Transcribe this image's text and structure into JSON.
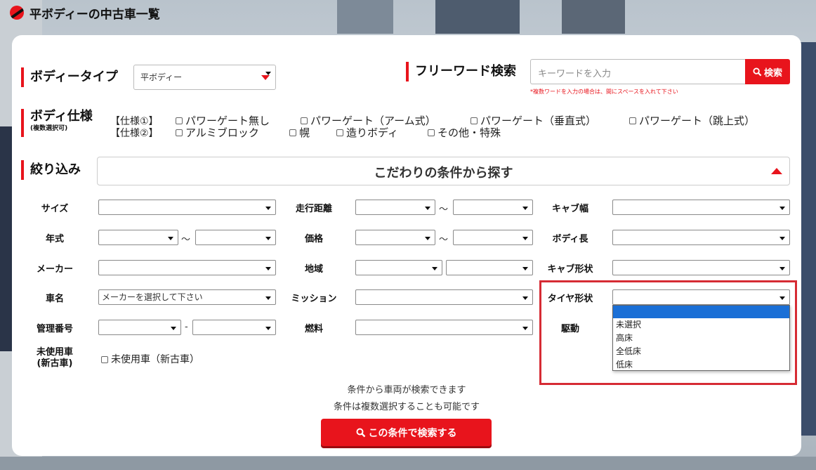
{
  "page": {
    "title": "平ボディーの中古車一覧"
  },
  "body_type": {
    "label": "ボディータイプ",
    "selected": "平ボディー"
  },
  "freeword": {
    "label": "フリーワード検索",
    "placeholder": "キーワードを入力",
    "button": "検索",
    "note": "*複数ワードを入力の場合は、間にスペースを入れて下さい"
  },
  "body_spec": {
    "label": "ボディ仕様",
    "sub": "(複数選択可)",
    "group1_label": "【仕様①】",
    "group1": [
      "パワーゲート無し",
      "パワーゲート（アーム式）",
      "パワーゲート（垂直式）",
      "パワーゲート（跳上式）"
    ],
    "group2_label": "【仕様②】",
    "group2": [
      "アルミブロック",
      "幌",
      "造りボディ",
      "その他・特殊"
    ]
  },
  "filter": {
    "label": "絞り込み",
    "bar_title": "こだわりの条件から探す"
  },
  "fields": {
    "size": "サイズ",
    "year": "年式",
    "maker": "メーカー",
    "car_name": "車名",
    "car_name_placeholder": "メーカーを選択して下さい",
    "mgmt_no": "管理番号",
    "unused": "未使用車\n(新古車)",
    "unused_checkbox": "未使用車（新古車）",
    "mileage": "走行距離",
    "price": "価格",
    "region": "地域",
    "mission": "ミッション",
    "fuel": "燃料",
    "cab_width": "キャブ幅",
    "body_length": "ボディ長",
    "cab_shape": "キャブ形状",
    "tire_shape": "タイヤ形状",
    "drive": "駆動",
    "tilde": "～",
    "dash": "-"
  },
  "tire_dropdown": {
    "options": [
      "",
      "未選択",
      "高床",
      "全低床",
      "低床"
    ],
    "highlighted_index": 0
  },
  "footer": {
    "line1": "条件から車両が検索できます",
    "line2": "条件は複数選択することも可能です",
    "button": "この条件で検索する"
  },
  "colors": {
    "accent": "#e8141c",
    "highlight": "#1a6fd6",
    "annotation": "#d62b34"
  }
}
